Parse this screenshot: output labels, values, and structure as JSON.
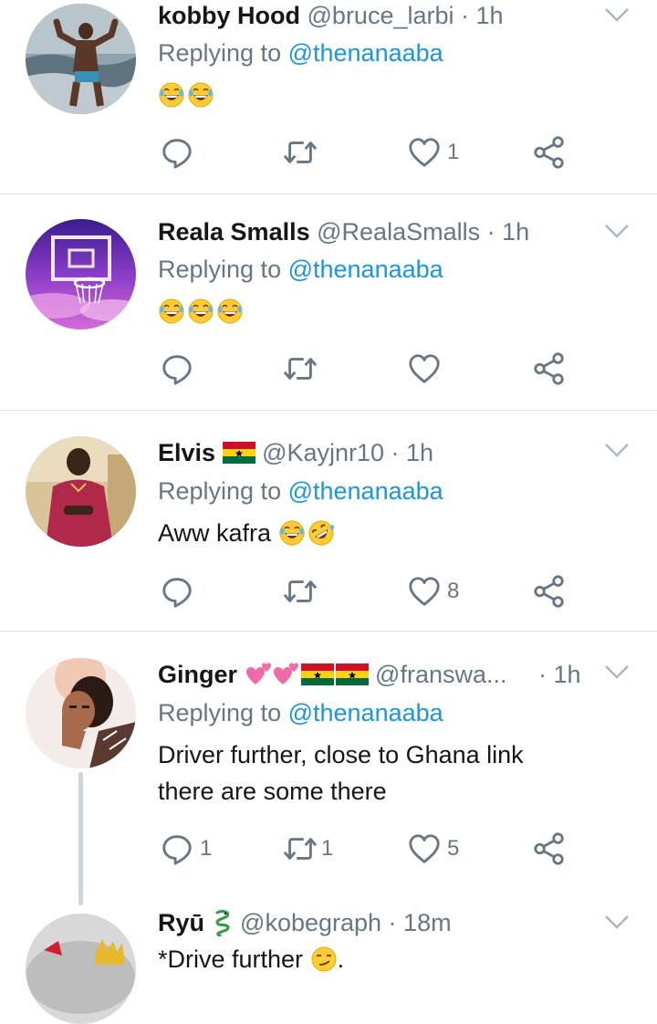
{
  "tweets": [
    {
      "name": "kobby Hood",
      "handle": "@bruce_larbi · 1h",
      "replying_prefix": "Replying to ",
      "replying_handle": "@thenanaaba",
      "text": "",
      "counts": {
        "reply": "",
        "retweet": "",
        "like": "1"
      }
    },
    {
      "name": "Reala Smalls",
      "handle": "@RealaSmalls · 1h",
      "replying_prefix": "Replying to ",
      "replying_handle": "@thenanaaba",
      "text": "",
      "counts": {
        "reply": "",
        "retweet": "",
        "like": ""
      }
    },
    {
      "name": "Elvis",
      "handle": "@Kayjnr10 · 1h",
      "replying_prefix": "Replying to ",
      "replying_handle": "@thenanaaba",
      "text": "Aww kafra",
      "counts": {
        "reply": "",
        "retweet": "",
        "like": "8"
      }
    },
    {
      "name": "Ginger",
      "handle": "@franswa...",
      "time": "· 1h",
      "replying_prefix": "Replying to ",
      "replying_handle": "@thenanaaba",
      "text_line1": "Driver further, close to Ghana link",
      "text_line2": "there are some there",
      "counts": {
        "reply": "1",
        "retweet": "1",
        "like": "5"
      }
    },
    {
      "name": "Ryū",
      "handle": "@kobegraph · 18m",
      "text": "*Drive further",
      "text_suffix": "."
    }
  ],
  "colors": {
    "accent": "#1b95e0",
    "secondary_text": "#657786",
    "primary_text": "#14171a",
    "divider": "#dfe4e8"
  },
  "icons": [
    "reply-icon",
    "retweet-icon",
    "like-icon",
    "share-icon",
    "caret-down-icon",
    "laughing-emoji",
    "rofl-emoji",
    "smirk-emoji",
    "hearts-emoji",
    "ghana-flag",
    "dragon-emoji"
  ]
}
